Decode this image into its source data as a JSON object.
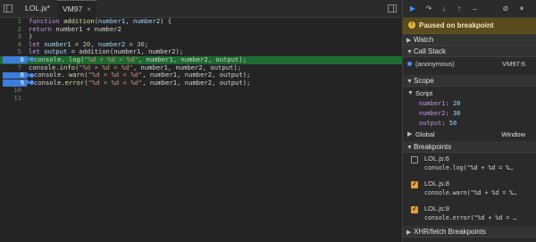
{
  "tabs": [
    {
      "label": "LOL.js*",
      "closable": false
    },
    {
      "label": "VM97",
      "closable": true,
      "close_glyph": "×"
    }
  ],
  "code": {
    "lines": [
      {
        "n": "1",
        "tokens": [
          [
            "kw",
            "function "
          ],
          [
            "fn",
            "addition"
          ],
          [
            "pl",
            "("
          ],
          [
            "var",
            "number1"
          ],
          [
            "pl",
            ", "
          ],
          [
            "var",
            "number2"
          ],
          [
            "pl",
            ") {"
          ]
        ]
      },
      {
        "n": "2",
        "tokens": [
          [
            "kw",
            "return "
          ],
          [
            "pl",
            "number1 + number2"
          ]
        ]
      },
      {
        "n": "3",
        "tokens": [
          [
            "pl",
            "}"
          ]
        ]
      },
      {
        "n": "4",
        "tokens": [
          [
            "kw",
            "let "
          ],
          [
            "var",
            "number1"
          ],
          [
            "pl",
            " = "
          ],
          [
            "num",
            "20"
          ],
          [
            "pl",
            ", "
          ],
          [
            "var",
            "number2"
          ],
          [
            "pl",
            " = "
          ],
          [
            "num",
            "30"
          ],
          [
            "pl",
            ";"
          ]
        ]
      },
      {
        "n": "5",
        "tokens": [
          [
            "kw",
            "let "
          ],
          [
            "var",
            "output"
          ],
          [
            "pl",
            " = addition(number1, number2);"
          ]
        ]
      },
      {
        "n": "6",
        "breakpoint": true,
        "executing": true,
        "tokens": [
          [
            "prop",
            "console. "
          ],
          [
            "fn",
            "log"
          ],
          [
            "pl",
            "("
          ],
          [
            "str",
            "\"%d + %d = %d\""
          ],
          [
            "pl",
            ", number1, number2, output);"
          ]
        ]
      },
      {
        "n": "7",
        "tokens": [
          [
            "pl",
            "console."
          ],
          [
            "fn",
            "info"
          ],
          [
            "pl",
            "("
          ],
          [
            "str",
            "\"%d + %d = %d\""
          ],
          [
            "pl",
            ", number1, number2, output);"
          ]
        ]
      },
      {
        "n": "8",
        "breakpoint": true,
        "tokens": [
          [
            "pl",
            "console. "
          ],
          [
            "fn",
            "warn"
          ],
          [
            "pl",
            "("
          ],
          [
            "str",
            "\"%d + %d = %d\""
          ],
          [
            "pl",
            ", number1, number2, output);"
          ]
        ]
      },
      {
        "n": "9",
        "breakpoint": true,
        "tokens": [
          [
            "pl",
            "console."
          ],
          [
            "fn",
            "error"
          ],
          [
            "pl",
            "("
          ],
          [
            "str",
            "\"%d + %d = %d\""
          ],
          [
            "pl",
            ", number1, number2, output);"
          ]
        ]
      },
      {
        "n": "10",
        "tokens": []
      },
      {
        "n": "11",
        "tokens": []
      }
    ]
  },
  "debugger": {
    "paused_label": "Paused on breakpoint",
    "sections": {
      "watch": "Watch",
      "call_stack": "Call Stack",
      "scope": "Scope",
      "breakpoints": "Breakpoints",
      "xhr": "XHR/fetch Breakpoints"
    },
    "call_stack": [
      {
        "name": "(anonymous)",
        "location": "VM97:6"
      }
    ],
    "scope": {
      "script_label": "Script",
      "vars": [
        {
          "name": "number1",
          "value": "20"
        },
        {
          "name": "number2",
          "value": "30"
        },
        {
          "name": "output",
          "value": "50"
        }
      ],
      "global_label": "Global",
      "global_value": "Window"
    },
    "breakpoints": [
      {
        "file": "LOL.js:6",
        "code": "console.log(\"%d + %d = %…",
        "checked": false
      },
      {
        "file": "LOL.js:8",
        "code": "console.warn(\"%d + %d = %…",
        "checked": true
      },
      {
        "file": "LOL.js:9",
        "code": "console.error(\"%d + %d = …",
        "checked": true
      }
    ]
  },
  "icons": {
    "resume": "resume-icon",
    "step_over": "step-over-icon",
    "step_into": "step-into-icon",
    "step_out": "step-out-icon",
    "step": "step-icon",
    "deactivate": "deactivate-breakpoints-icon",
    "pause_exceptions": "pause-on-exceptions-icon"
  },
  "colors": {
    "exec_line": "#1e6b32",
    "breakpoint": "#3d7ddb",
    "paused_banner": "#5a4b1c",
    "checkbox_on": "#e39f3a"
  }
}
